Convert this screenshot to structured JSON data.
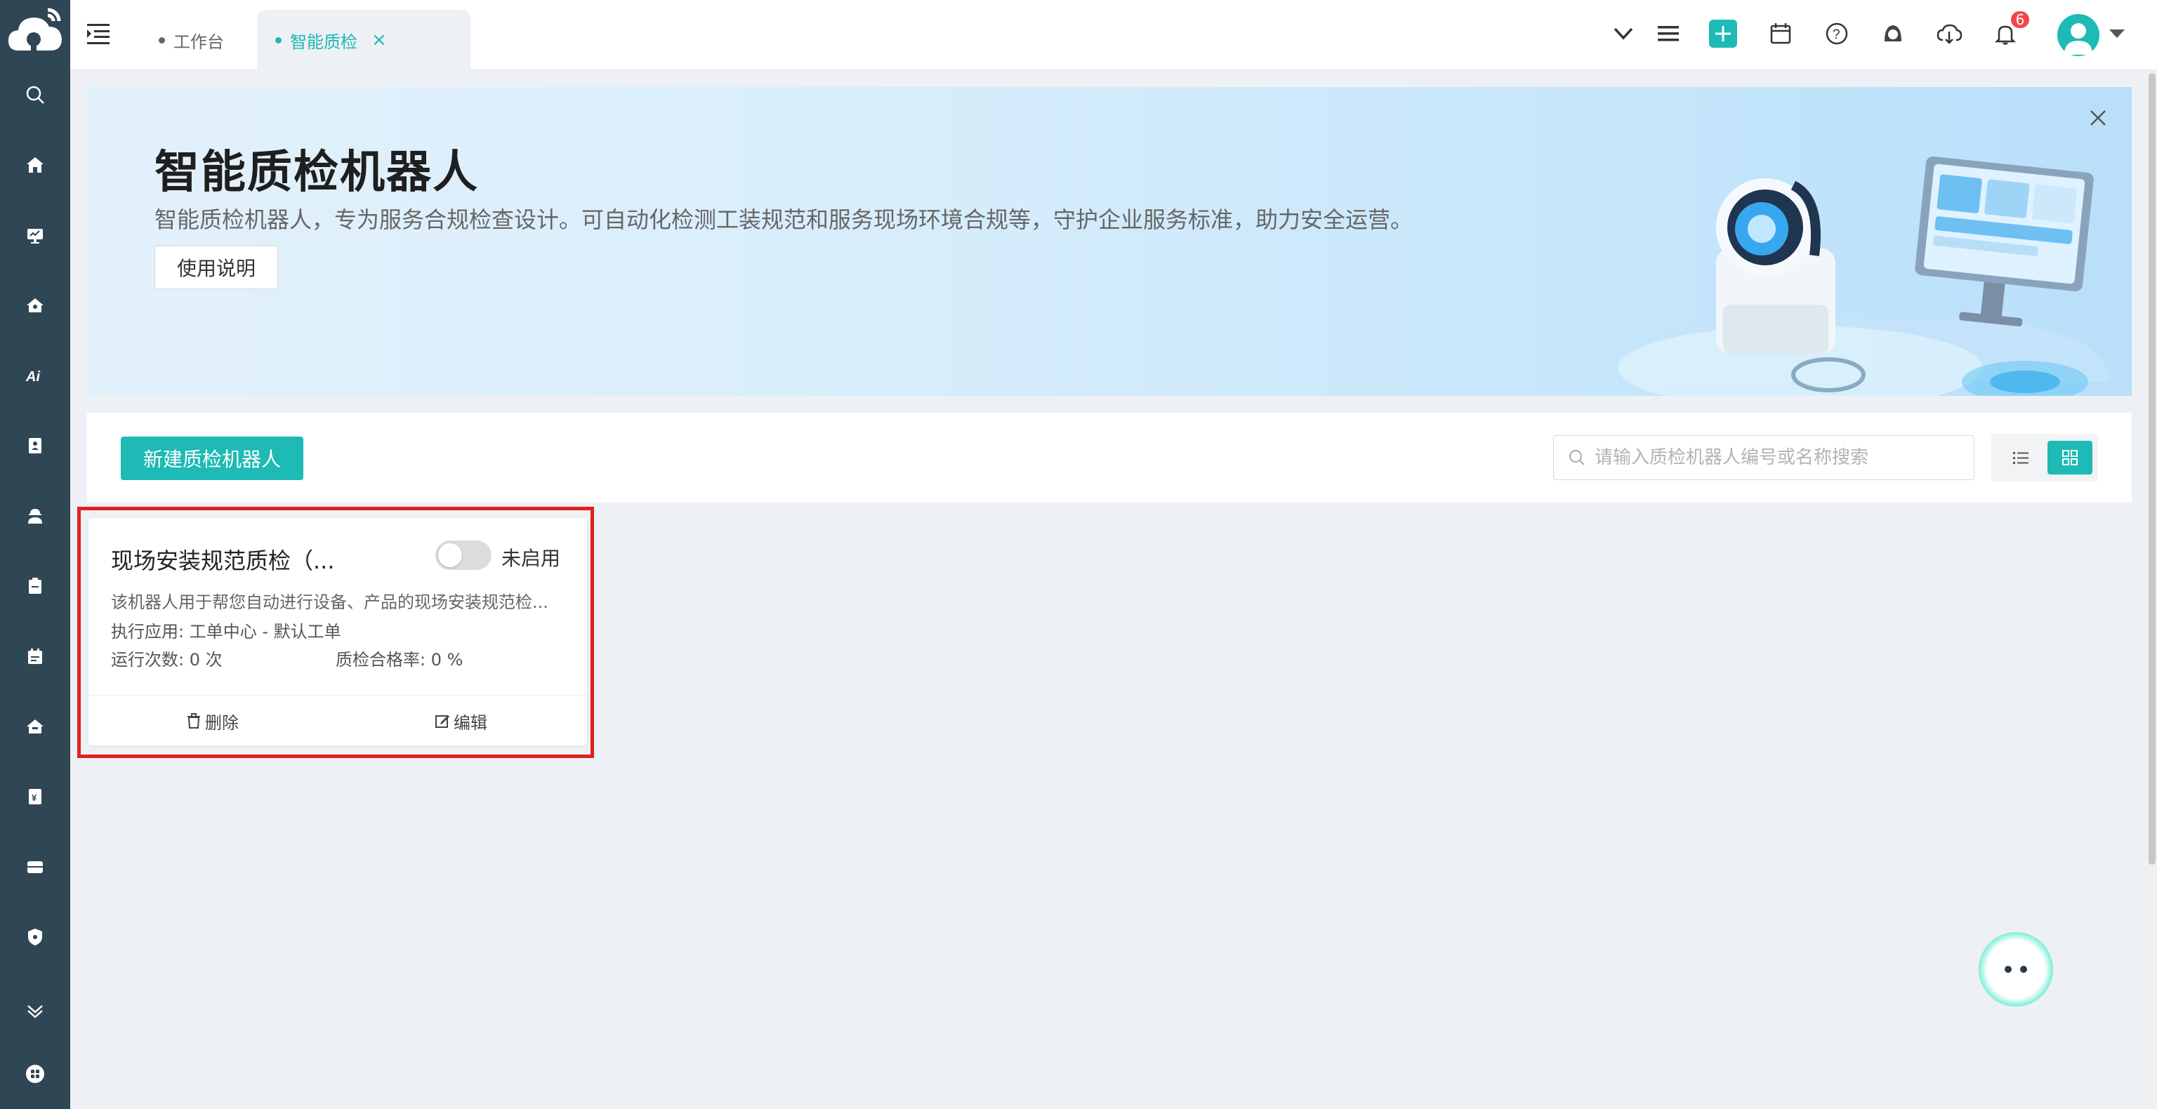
{
  "sidebar": {
    "icons": [
      "logo-cloud-icon",
      "search-icon",
      "home-icon",
      "monitor-icon",
      "house-icon",
      "ai-icon",
      "contact-icon",
      "worker-icon",
      "clipboard-icon",
      "calendar-task-icon",
      "house-alt-icon",
      "yen-icon",
      "storage-icon",
      "shield-icon",
      "chevron-double-down-icon",
      "apps-icon"
    ]
  },
  "header": {
    "tabs": [
      {
        "label": "工作台",
        "active": false
      },
      {
        "label": "智能质检",
        "active": true,
        "close": "×"
      }
    ],
    "notification_count": "6",
    "accent_color": "#1ebab5",
    "badge_color": "#f24848"
  },
  "banner": {
    "title": "智能质检机器人",
    "description": "智能质检机器人，专为服务合规检查设计。可自动化检测工装规范和服务现场环境合规等，守护企业服务标准，助力安全运营。",
    "guide_button": "使用说明"
  },
  "toolbar": {
    "new_button": "新建质检机器人",
    "search_placeholder": "请输入质检机器人编号或名称搜索",
    "view_mode": "grid"
  },
  "cards": [
    {
      "title": "现场安装规范质检（...",
      "enabled": false,
      "status_label": "未启用",
      "description": "该机器人用于帮您自动进行设备、产品的现场安装规范检...",
      "app_line": "执行应用: 工单中心 - 默认工单",
      "runs_line": "运行次数:  0 次",
      "rate_line": "质检合格率:  0 %",
      "delete_label": "删除",
      "edit_label": "编辑"
    }
  ]
}
